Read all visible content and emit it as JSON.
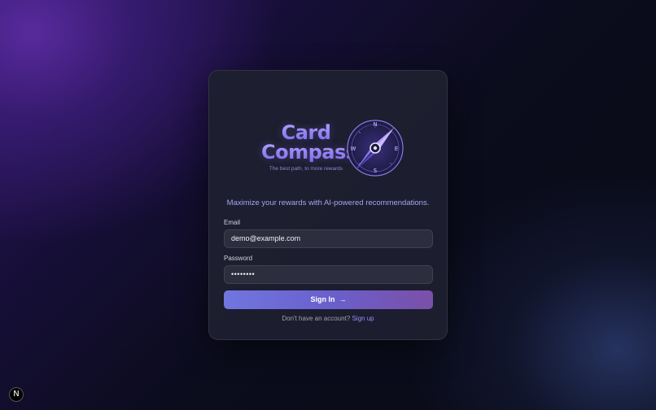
{
  "logo": {
    "line1": "Card",
    "line2": "Compass",
    "tagline": "The best path, to more rewards",
    "compass_points": {
      "n": "N",
      "e": "E",
      "s": "S",
      "w": "W"
    }
  },
  "subtitle": "Maximize your rewards with AI-powered recommendations.",
  "form": {
    "email_label": "Email",
    "email_value": "demo@example.com",
    "password_label": "Password",
    "password_value": "••••••••",
    "signin_label": "Sign In",
    "signin_arrow": "→"
  },
  "footer": {
    "prompt": "Don't have an account?",
    "signup_label": "Sign up"
  },
  "dev_badge": {
    "label": "N",
    "icon": "nextjs-icon"
  },
  "colors": {
    "accent": "#7c6cf0",
    "button_start": "#7176df",
    "button_end": "#7a4fa8",
    "link": "#9a8cff"
  }
}
